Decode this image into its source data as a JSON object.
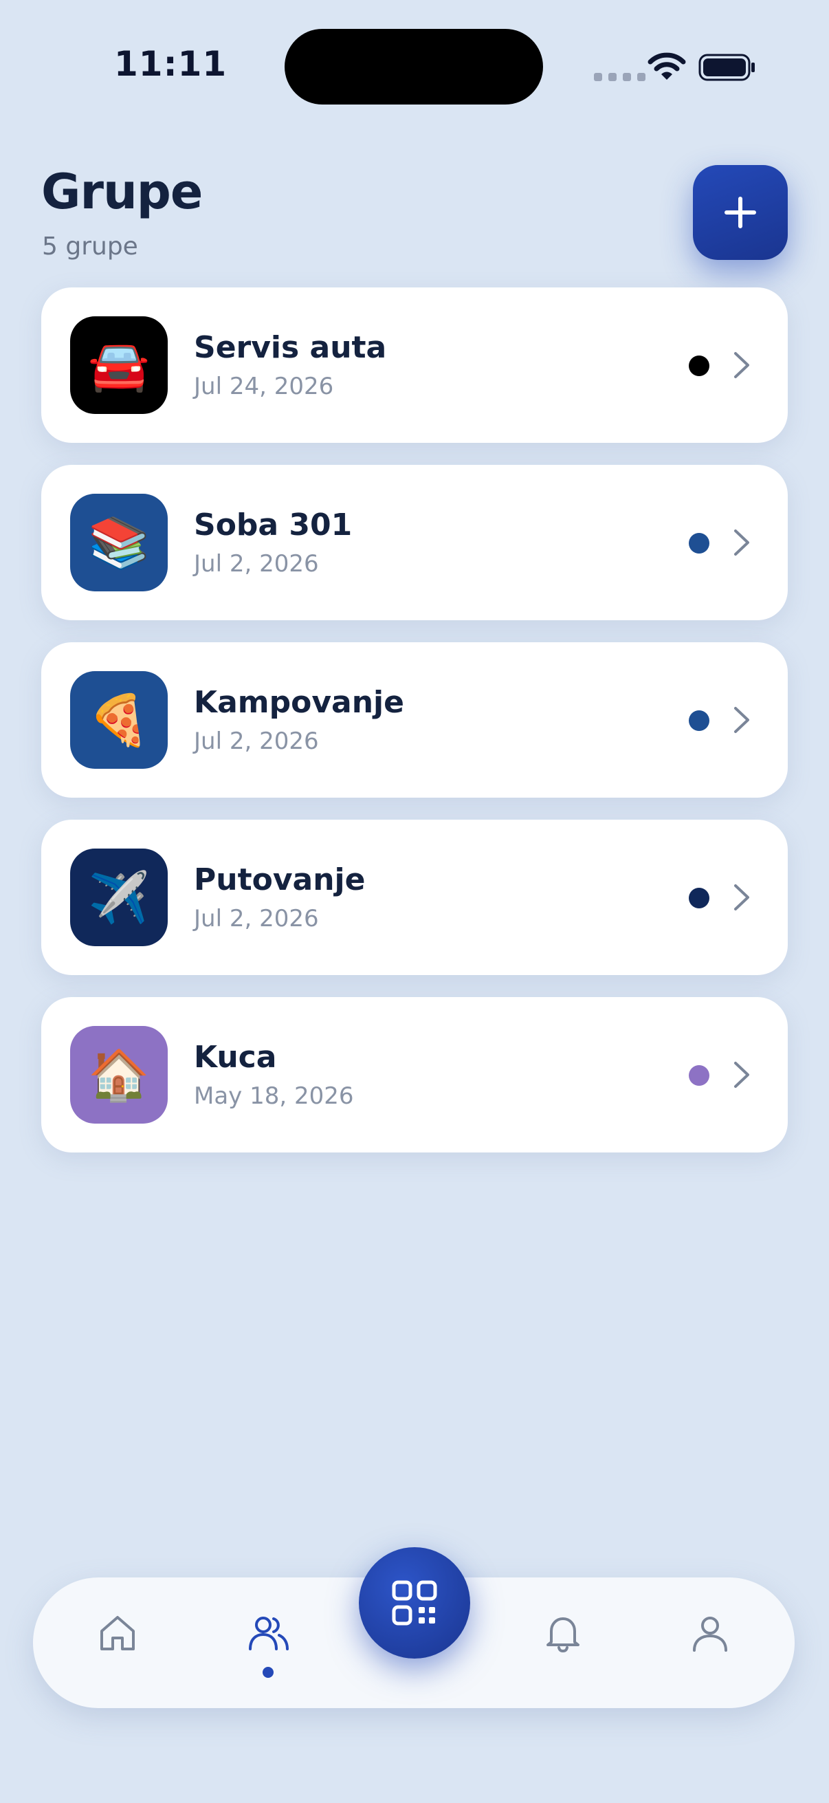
{
  "status_bar": {
    "time": "11:11"
  },
  "header": {
    "title": "Grupe",
    "subtitle": "5 grupe",
    "add_button_icon": "plus-icon"
  },
  "groups": [
    {
      "name": "Servis auta",
      "date": "Jul 24, 2026",
      "emoji": "🚘",
      "icon_bg": "#000000",
      "dot_color": "#000000"
    },
    {
      "name": "Soba 301",
      "date": "Jul 2, 2026",
      "emoji": "📚",
      "icon_bg": "#1e4f93",
      "dot_color": "#1e4f93"
    },
    {
      "name": "Kampovanje",
      "date": "Jul 2, 2026",
      "emoji": "🍕",
      "icon_bg": "#1e4f93",
      "dot_color": "#1e4f93"
    },
    {
      "name": "Putovanje",
      "date": "Jul 2, 2026",
      "emoji": "✈️",
      "icon_bg": "#10285a",
      "dot_color": "#10285a"
    },
    {
      "name": "Kuca",
      "date": "May 18, 2026",
      "emoji": "🏠",
      "icon_bg": "#8d72c4",
      "dot_color": "#8d72c4"
    }
  ],
  "bottom_nav": {
    "items": [
      {
        "icon": "home-icon",
        "active": false
      },
      {
        "icon": "users-icon",
        "active": true
      },
      {
        "icon": "qr-scan-icon",
        "active": false
      },
      {
        "icon": "bell-icon",
        "active": false
      },
      {
        "icon": "profile-icon",
        "active": false
      }
    ]
  },
  "colors": {
    "accent": "#2449b8",
    "background": "#dae5f3",
    "title": "#14223f",
    "muted": "#8993a5"
  }
}
